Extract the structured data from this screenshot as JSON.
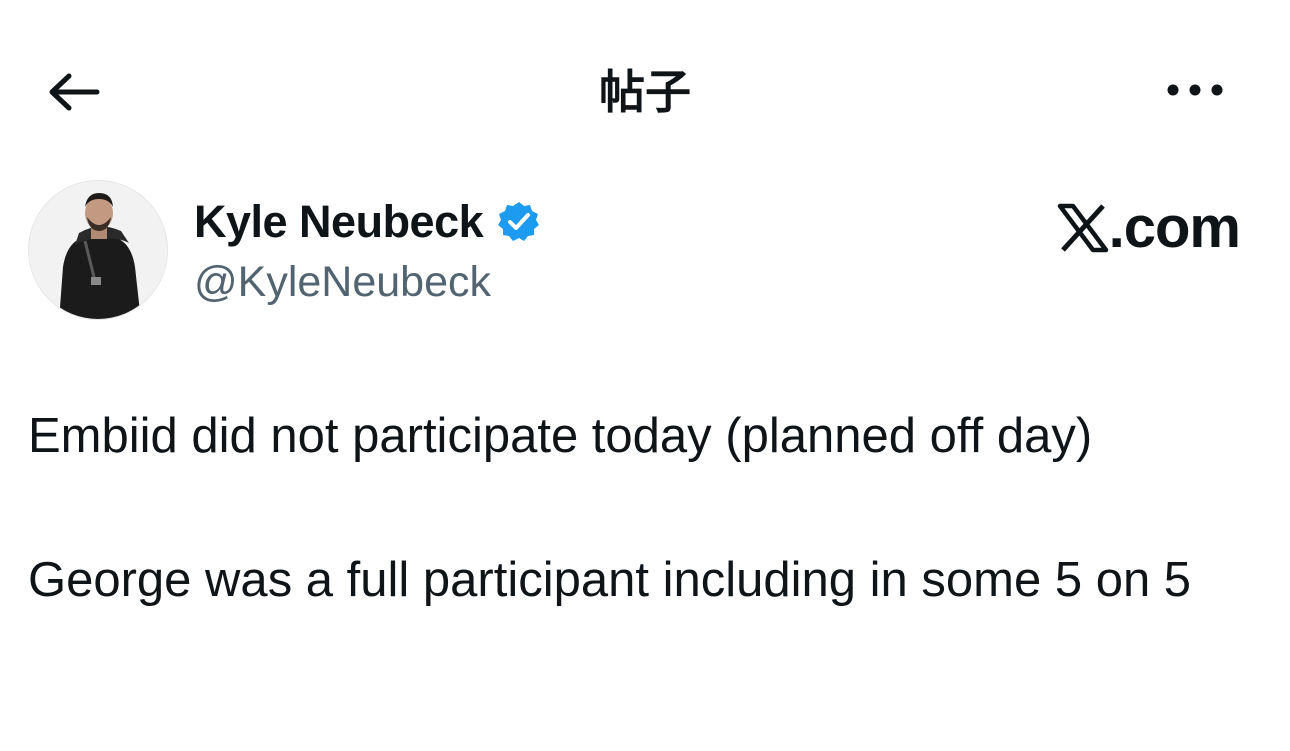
{
  "header": {
    "title": "帖子",
    "back_icon": "arrow-left-icon",
    "more_icon": "more-horizontal-icon"
  },
  "author": {
    "name": "Kyle Neubeck",
    "handle": "@KyleNeubeck",
    "verified": true,
    "verified_icon": "verified-badge-icon",
    "verified_color": "#1d9bf0"
  },
  "brand": {
    "logo_icon": "x-logo-icon",
    "text": ".com"
  },
  "post": {
    "paragraphs": [
      "Embiid did not participate today (planned off day)",
      "George was a full participant including in some 5 on 5"
    ]
  },
  "colors": {
    "text_primary": "#0f1419",
    "text_secondary": "#536471",
    "background": "#ffffff"
  }
}
